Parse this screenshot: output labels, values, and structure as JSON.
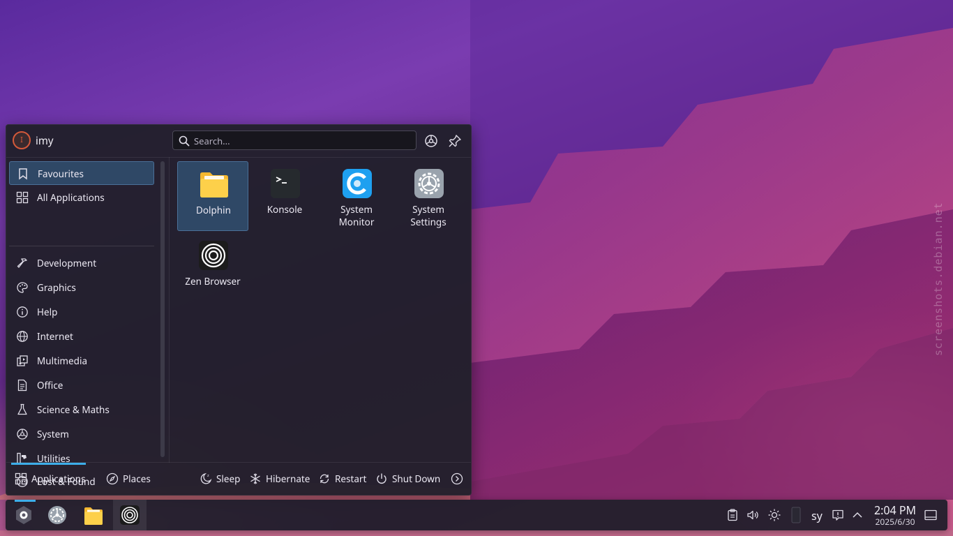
{
  "desktop": {
    "watermark": "screenshots.debian.net"
  },
  "launcher": {
    "user": {
      "initial": "I",
      "name": "imy"
    },
    "search": {
      "placeholder": "Search..."
    },
    "sidebar": [
      {
        "label": "Favourites",
        "icon": "bookmark-icon",
        "active": true
      },
      {
        "label": "All Applications",
        "icon": "grid-icon"
      },
      {
        "label": "Development",
        "icon": "hammer-icon"
      },
      {
        "label": "Graphics",
        "icon": "palette-icon"
      },
      {
        "label": "Help",
        "icon": "info-icon"
      },
      {
        "label": "Internet",
        "icon": "globe-icon"
      },
      {
        "label": "Multimedia",
        "icon": "multimedia-icon"
      },
      {
        "label": "Office",
        "icon": "document-icon"
      },
      {
        "label": "Science & Maths",
        "icon": "flask-icon"
      },
      {
        "label": "System",
        "icon": "system-icon"
      },
      {
        "label": "Utilities",
        "icon": "utilities-icon"
      },
      {
        "label": "Lost & Found",
        "icon": "ellipsis-icon"
      }
    ],
    "apps": [
      {
        "label": "Dolphin",
        "icon": "dolphin-folder-icon",
        "selected": true
      },
      {
        "label": "Konsole",
        "icon": "konsole-terminal-icon"
      },
      {
        "label": "System Monitor",
        "icon": "system-monitor-icon"
      },
      {
        "label": "System Settings",
        "icon": "system-settings-icon"
      },
      {
        "label": "Zen Browser",
        "icon": "zen-browser-icon"
      }
    ],
    "footer": {
      "applications": "Applications",
      "places": "Places",
      "sleep": "Sleep",
      "hibernate": "Hibernate",
      "restart": "Restart",
      "shutdown": "Shut Down"
    }
  },
  "taskbar": {
    "keyboard_layout": "sy",
    "clock": {
      "time": "2:04 PM",
      "date": "2025/6/30"
    }
  },
  "colors": {
    "accent": "#3daee9",
    "selection": "#2f4866",
    "panel": "#211f2b"
  }
}
